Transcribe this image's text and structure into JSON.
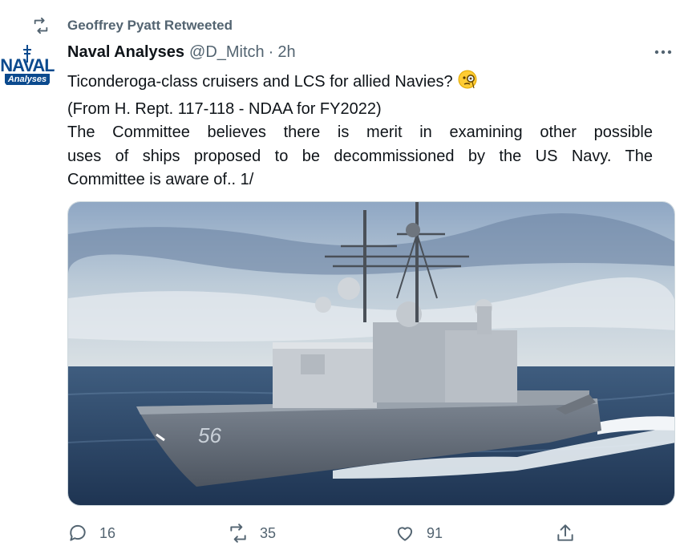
{
  "retweet_banner": {
    "text": "Geoffrey Pyatt Retweeted",
    "icon": "retweet-icon"
  },
  "author": {
    "name": "Naval Analyses",
    "handle": "@D_Mitch",
    "separator": "·",
    "time": "2h",
    "avatar_text_top": "NAVAL",
    "avatar_text_bottom": "Analyses"
  },
  "tweet": {
    "line1": "Ticonderoga-class cruisers and LCS for allied Navies?",
    "emoji": "monocle-face-icon",
    "line2": "(From H. Rept. 117-118 - NDAA for FY2022)",
    "line3": "The Committee believes there is merit in examining other possible",
    "line4": "uses of ships proposed to be decommissioned by the US Navy. The",
    "line5": "Committee is aware of.. 1/"
  },
  "media": {
    "hull_number": "56"
  },
  "actions": {
    "reply_count": "16",
    "retweet_count": "35",
    "like_count": "91"
  },
  "colors": {
    "secondary_text": "#536471",
    "primary_text": "#0f1419",
    "border": "#cfd9de"
  }
}
